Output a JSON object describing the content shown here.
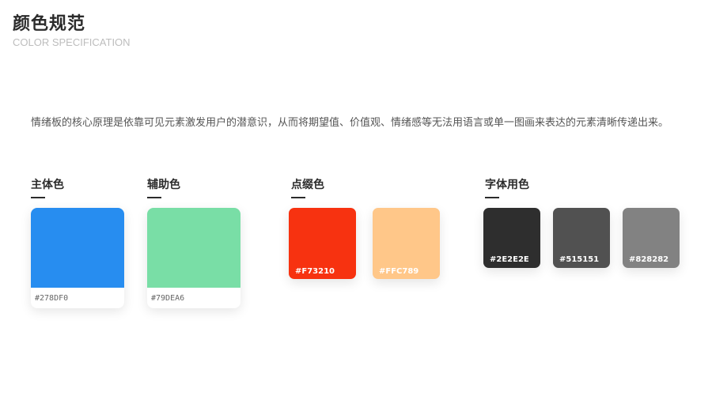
{
  "header": {
    "title": "颜色规范",
    "subtitle": "COLOR SPECIFICATION"
  },
  "description": "情绪板的核心原理是依靠可见元素激发用户的潜意识，从而将期望值、价值观、情绪感等无法用语言或单一图画来表达的元素清晰传递出来。",
  "groups": {
    "primary": {
      "label": "主体色",
      "swatches": [
        {
          "code": "#278DF0",
          "color": "#278DF0"
        }
      ]
    },
    "secondary": {
      "label": "辅助色",
      "swatches": [
        {
          "code": "#79DEA6",
          "color": "#79DEA6"
        }
      ]
    },
    "accent": {
      "label": "点缀色",
      "swatches": [
        {
          "code": "#F73210",
          "color": "#F73210"
        },
        {
          "code": "#FFC789",
          "color": "#FFC789"
        }
      ]
    },
    "text": {
      "label": "字体用色",
      "swatches": [
        {
          "code": "#2E2E2E",
          "color": "#2E2E2E"
        },
        {
          "code": "#515151",
          "color": "#515151"
        },
        {
          "code": "#828282",
          "color": "#828282"
        }
      ]
    }
  }
}
